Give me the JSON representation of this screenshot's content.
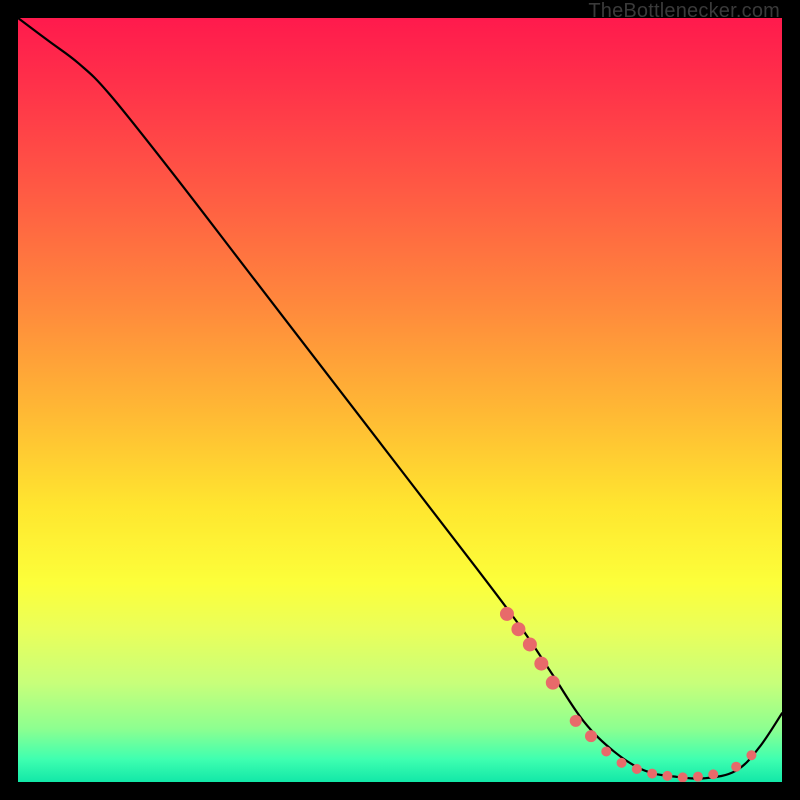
{
  "watermark": {
    "text": "TheBottlenecker.com"
  },
  "chart_data": {
    "type": "line",
    "title": "",
    "xlabel": "",
    "ylabel": "",
    "xlim": [
      0,
      100
    ],
    "ylim": [
      0,
      100
    ],
    "axes_visible": false,
    "grid": false,
    "legend": false,
    "background_gradient": {
      "direction": "top-to-bottom",
      "stops": [
        {
          "pos": 0.0,
          "color": "#ff1a4d"
        },
        {
          "pos": 0.08,
          "color": "#ff2f4a"
        },
        {
          "pos": 0.22,
          "color": "#ff5844"
        },
        {
          "pos": 0.38,
          "color": "#ff8a3c"
        },
        {
          "pos": 0.52,
          "color": "#ffba34"
        },
        {
          "pos": 0.64,
          "color": "#ffe62f"
        },
        {
          "pos": 0.74,
          "color": "#fcff3a"
        },
        {
          "pos": 0.8,
          "color": "#eaff5a"
        },
        {
          "pos": 0.87,
          "color": "#c8ff7a"
        },
        {
          "pos": 0.93,
          "color": "#8dff90"
        },
        {
          "pos": 0.97,
          "color": "#3fffb0"
        },
        {
          "pos": 1.0,
          "color": "#12e8a8"
        }
      ]
    },
    "series": [
      {
        "name": "bottleneck-curve",
        "color": "#000000",
        "x": [
          0,
          4,
          8,
          12,
          20,
          30,
          40,
          50,
          60,
          66,
          70,
          74,
          78,
          82,
          86,
          90,
          94,
          97,
          100
        ],
        "y": [
          100,
          97,
          94,
          90,
          80,
          67,
          54,
          41,
          28,
          20,
          14,
          8,
          4,
          1.5,
          0.7,
          0.5,
          1.5,
          4.5,
          9
        ]
      }
    ],
    "markers": {
      "name": "highlight-dots",
      "color": "#e86a6a",
      "points": [
        {
          "x": 64,
          "y": 22
        },
        {
          "x": 65.5,
          "y": 20
        },
        {
          "x": 67,
          "y": 18
        },
        {
          "x": 68.5,
          "y": 15.5
        },
        {
          "x": 70,
          "y": 13
        },
        {
          "x": 73,
          "y": 8
        },
        {
          "x": 75,
          "y": 6
        },
        {
          "x": 77,
          "y": 4
        },
        {
          "x": 79,
          "y": 2.5
        },
        {
          "x": 81,
          "y": 1.7
        },
        {
          "x": 83,
          "y": 1.1
        },
        {
          "x": 85,
          "y": 0.8
        },
        {
          "x": 87,
          "y": 0.6
        },
        {
          "x": 89,
          "y": 0.7
        },
        {
          "x": 91,
          "y": 1.0
        },
        {
          "x": 94,
          "y": 2.0
        },
        {
          "x": 96,
          "y": 3.5
        }
      ]
    }
  }
}
